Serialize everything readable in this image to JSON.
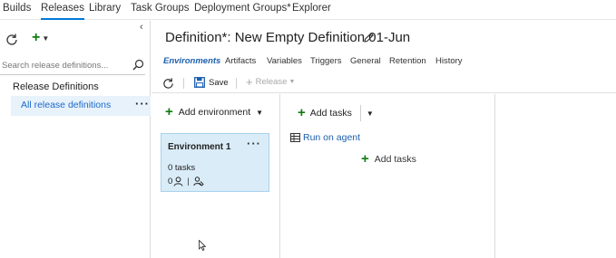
{
  "topnav": {
    "tabs": [
      {
        "label": "Builds"
      },
      {
        "label": "Releases"
      },
      {
        "label": "Library"
      },
      {
        "label": "Task Groups"
      },
      {
        "label": "Deployment Groups*"
      },
      {
        "label": "Explorer"
      }
    ],
    "active_tab": "Releases",
    "accent_color": "#0078d7"
  },
  "sidebar": {
    "search_placeholder": "Search release definitions...",
    "heading": "Release Definitions",
    "items": [
      {
        "label": "All release definitions",
        "selected": true
      }
    ],
    "more_label": "···"
  },
  "definition": {
    "title": "Definition*: New Empty Definition 01-Jun",
    "tabs": [
      {
        "label": "Environments"
      },
      {
        "label": "Artifacts"
      },
      {
        "label": "Variables"
      },
      {
        "label": "Triggers"
      },
      {
        "label": "General"
      },
      {
        "label": "Retention"
      },
      {
        "label": "History"
      }
    ],
    "active_tab": "Environments"
  },
  "toolbar": {
    "save_label": "Save",
    "release_label": "Release"
  },
  "environments": {
    "add_label": "Add environment",
    "cards": [
      {
        "name": "Environment 1",
        "tasks_label": "0 tasks",
        "approvers_count": "0",
        "more_label": "···"
      }
    ]
  },
  "tasks": {
    "add_label": "Add tasks",
    "phase_label": "Run on agent",
    "inline_add_label": "Add tasks"
  },
  "colors": {
    "green_plus": "#107c10",
    "link_blue": "#1b5fad",
    "selected_bg": "#e8f2fb",
    "card_bg": "#daecf8"
  }
}
